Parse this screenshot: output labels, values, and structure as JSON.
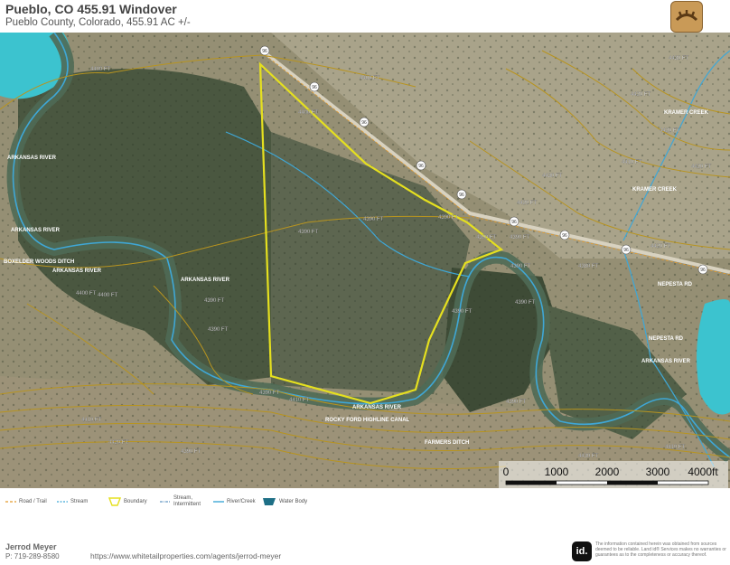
{
  "header": {
    "title": "Pueblo, CO 455.91 Windover",
    "subtitle": "Pueblo County, Colorado, 455.91 AC +/-"
  },
  "map": {
    "highway_shield": "96",
    "contour_labels": [
      "4400 FT",
      "4400 FT",
      "4400 FT",
      "4400 FT",
      "4390 FT",
      "4390 FT",
      "4390 FT",
      "4390 FT",
      "4390 FT",
      "4390 FT",
      "4390 FT",
      "4390 FT",
      "4390 FT",
      "4400 FT",
      "4410 FT",
      "4410 FT",
      "4420 FT",
      "4420 FT",
      "4430 FT",
      "4420 FT",
      "4430 FT",
      "4410 FT",
      "4420 FT",
      "4420 FT",
      "4380 FT",
      "4390 FT",
      "4390 FT",
      "4390 FT",
      "4430 FT",
      "4410 FT",
      "4420 FT",
      "4390 FT"
    ],
    "water_labels": [
      "ARKANSAS RIVER",
      "ARKANSAS RIVER",
      "ARKANSAS RIVER",
      "ARKANSAS RIVER",
      "ARKANSAS RIVER",
      "ARKANSAS RIVER",
      "KRAMER CREEK",
      "KRAMER CREEK"
    ],
    "road_labels": [
      "BOXELDER WOODS DITCH",
      "NEPESTA RD",
      "NEPESTA RD",
      "ROCKY FORD HIGHLINE CANAL",
      "FARMERS DITCH"
    ],
    "scale_ticks": [
      "0",
      "1000",
      "2000",
      "3000",
      "4000ft"
    ],
    "colors": {
      "boundary": "#e5e01f",
      "contour": "#b8941f",
      "stream": "#3fa7d6",
      "water": "#3cc3cf",
      "terrain": "#8a8f6a",
      "vegetation": "#3c4a33"
    }
  },
  "legend": {
    "road_trail": "Road / Trail",
    "stream": "Stream",
    "boundary": "Boundary",
    "stream_intermittent": "Stream, Intermittent",
    "river_creek": "River/Creek",
    "water_body": "Water Body"
  },
  "footer": {
    "agent_name": "Jerrod Meyer",
    "phone": "P: 719-289-8580",
    "url": "https://www.whitetailproperties.com/agents/jerrod-meyer",
    "badge": "id.",
    "disclaimer": "The information contained herein was obtained from sources deemed to be reliable. Land id® Services makes no warranties or guarantees as to the completeness or accuracy thereof."
  }
}
